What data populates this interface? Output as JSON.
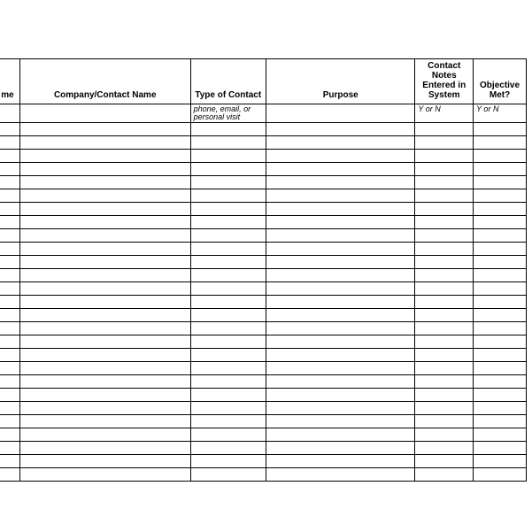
{
  "headers": {
    "col1": "me",
    "col2": "Company/Contact Name",
    "col3": "Type of Contact",
    "col4": "Purpose",
    "col5": "Contact Notes Entered in System",
    "col6": "Objective Met?"
  },
  "hints": {
    "col3": "phone, email, or personal visit",
    "col5": "Y or N",
    "col6": "Y or N"
  },
  "blank_rows": 27
}
